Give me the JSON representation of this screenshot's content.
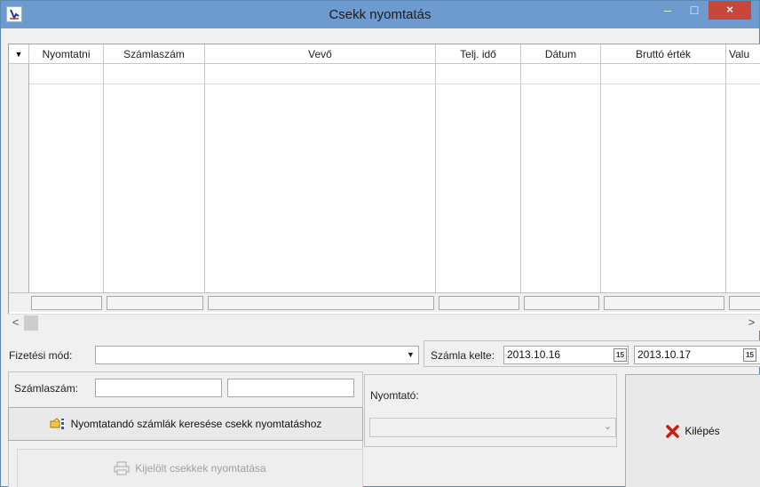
{
  "window": {
    "title": "Csekk nyomtatás",
    "minimize_glyph": "–",
    "maximize_glyph": "□",
    "close_glyph": "×"
  },
  "grid": {
    "indicator_glyph": "▼",
    "columns": [
      "Nyomtatni",
      "Számlaszám",
      "Vevő",
      "Telj. idő",
      "Dátum",
      "Bruttó érték",
      "Valu"
    ],
    "rows": []
  },
  "scrollbar": {
    "left_arrow": "<",
    "right_arrow": ">"
  },
  "filters": {
    "payment_label": "Fizetési mód:",
    "payment_value": "",
    "invoice_date_label": "Számla kelte:",
    "date_from": "2013.10.16",
    "date_to": "2013.10.17",
    "calendar_glyph": "15"
  },
  "search": {
    "invoice_label": "Számlaszám:",
    "invoice_from": "",
    "invoice_to": "",
    "search_button_label": "Nyomtatandó számlák keresése csekk nyomtatáshoz",
    "print_button_label": "Kijelölt csekkek nyomtatása"
  },
  "printer": {
    "label": "Nyomtató:",
    "value": ""
  },
  "exit": {
    "label": "Kilépés"
  },
  "colors": {
    "titlebar": "#6d9bcf",
    "close_button": "#c7473a",
    "exit_icon": "#c21f12"
  }
}
